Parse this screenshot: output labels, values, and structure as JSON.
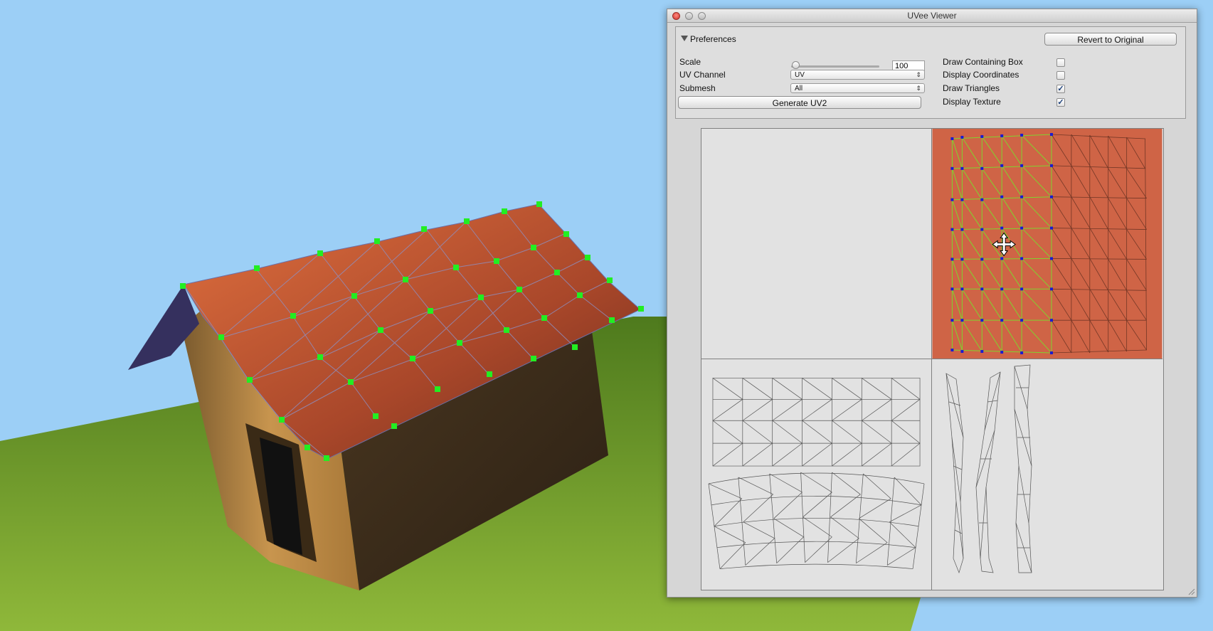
{
  "window": {
    "title": "UVee Viewer"
  },
  "preferences": {
    "header": "Preferences",
    "revert_button": "Revert to Original",
    "scale_label": "Scale",
    "scale_value": "100",
    "scale_slider_fraction": 0.05,
    "uv_channel_label": "UV Channel",
    "uv_channel_value": "UV",
    "submesh_label": "Submesh",
    "submesh_value": "All",
    "generate_button": "Generate UV2",
    "toggles": [
      {
        "label": "Draw Containing Box",
        "checked": false
      },
      {
        "label": "Display Coordinates",
        "checked": false
      },
      {
        "label": "Draw Triangles",
        "checked": true
      },
      {
        "label": "Display Texture",
        "checked": true
      }
    ]
  },
  "colors": {
    "sky": "#9ccff6",
    "grass": "#6f9a2a",
    "roof": "#c55a33",
    "vertex_handle": "#22ee22",
    "uv_selected_vertex": "#1b1bd0",
    "uv_texture": "#cf6446"
  },
  "icons": [
    "close-icon",
    "minimize-icon",
    "zoom-icon",
    "disclosure-triangle-icon",
    "move-cursor-icon",
    "checkmark-icon",
    "resize-grip-icon"
  ]
}
